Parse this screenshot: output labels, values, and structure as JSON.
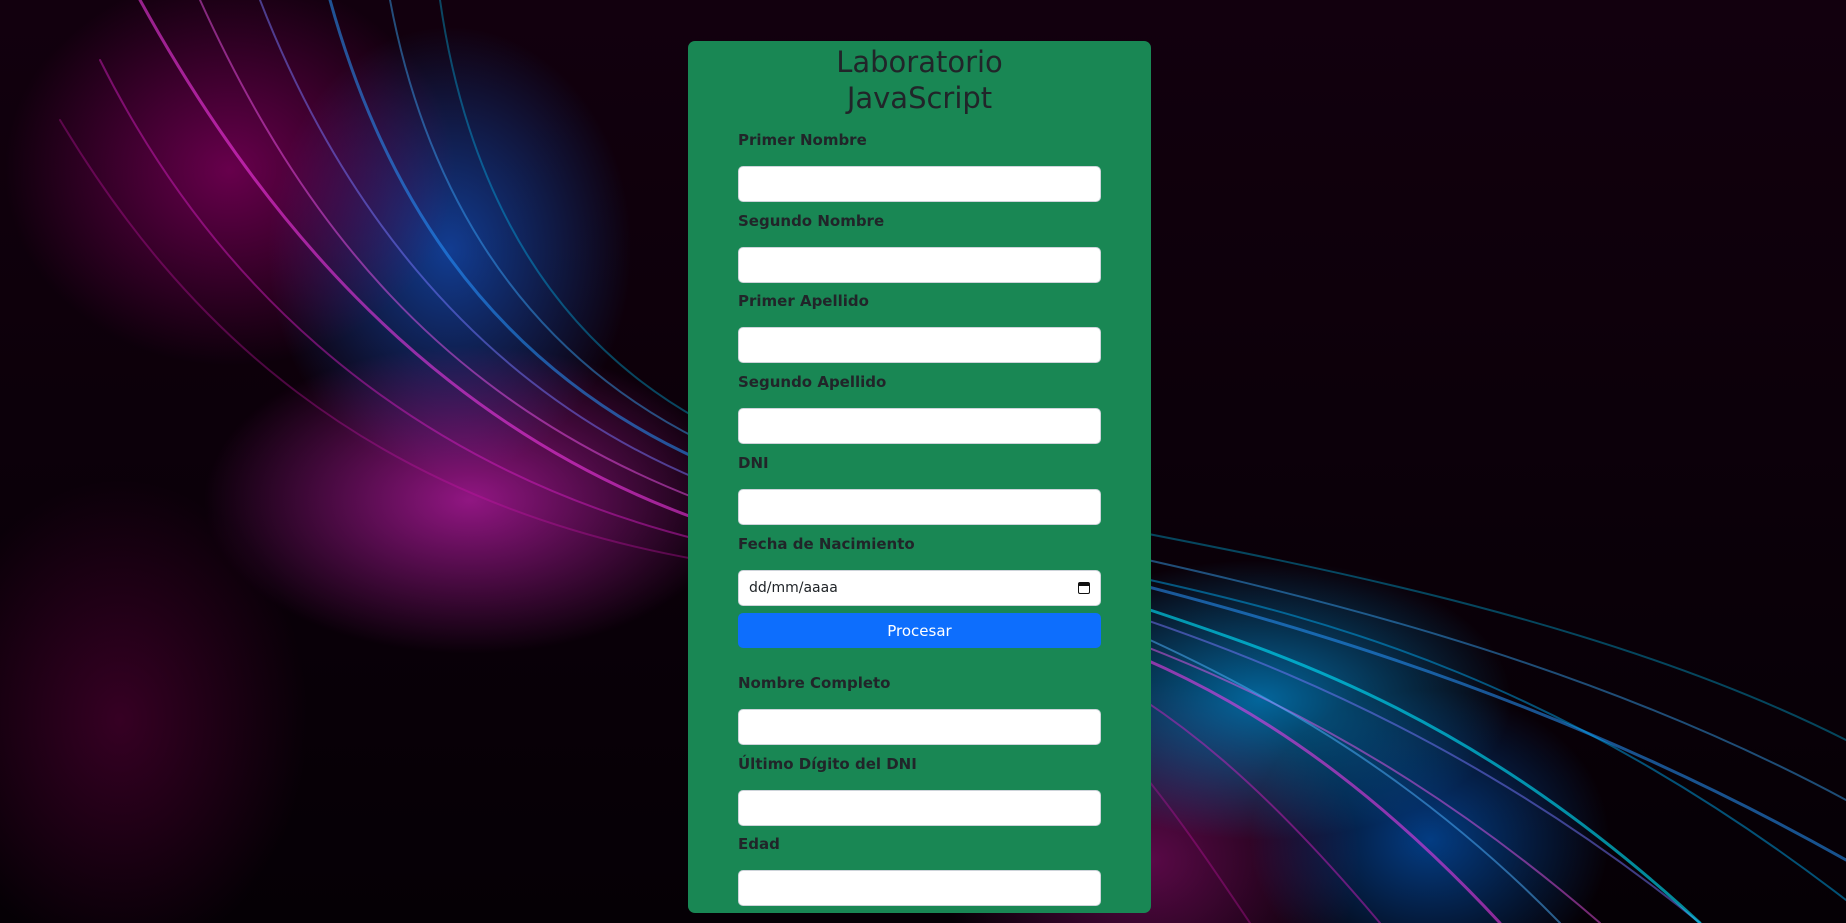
{
  "title_line1": "Laboratorio",
  "title_line2": "JavaScript",
  "form": {
    "primer_nombre": {
      "label": "Primer Nombre",
      "value": ""
    },
    "segundo_nombre": {
      "label": "Segundo Nombre",
      "value": ""
    },
    "primer_apellido": {
      "label": "Primer Apellido",
      "value": ""
    },
    "segundo_apellido": {
      "label": "Segundo Apellido",
      "value": ""
    },
    "dni": {
      "label": "DNI",
      "value": ""
    },
    "fecha_nacimiento": {
      "label": "Fecha de Nacimiento",
      "placeholder": "dd/mm/aaaa",
      "icon": "calendar-icon"
    },
    "submit_label": "Procesar"
  },
  "results": {
    "nombre_completo": {
      "label": "Nombre Completo",
      "value": ""
    },
    "ultimo_digito_dni": {
      "label": "Último Dígito del DNI",
      "value": ""
    },
    "edad": {
      "label": "Edad",
      "value": ""
    }
  },
  "colors": {
    "card": "#198754",
    "button": "#0d6efd",
    "text": "#212529"
  }
}
